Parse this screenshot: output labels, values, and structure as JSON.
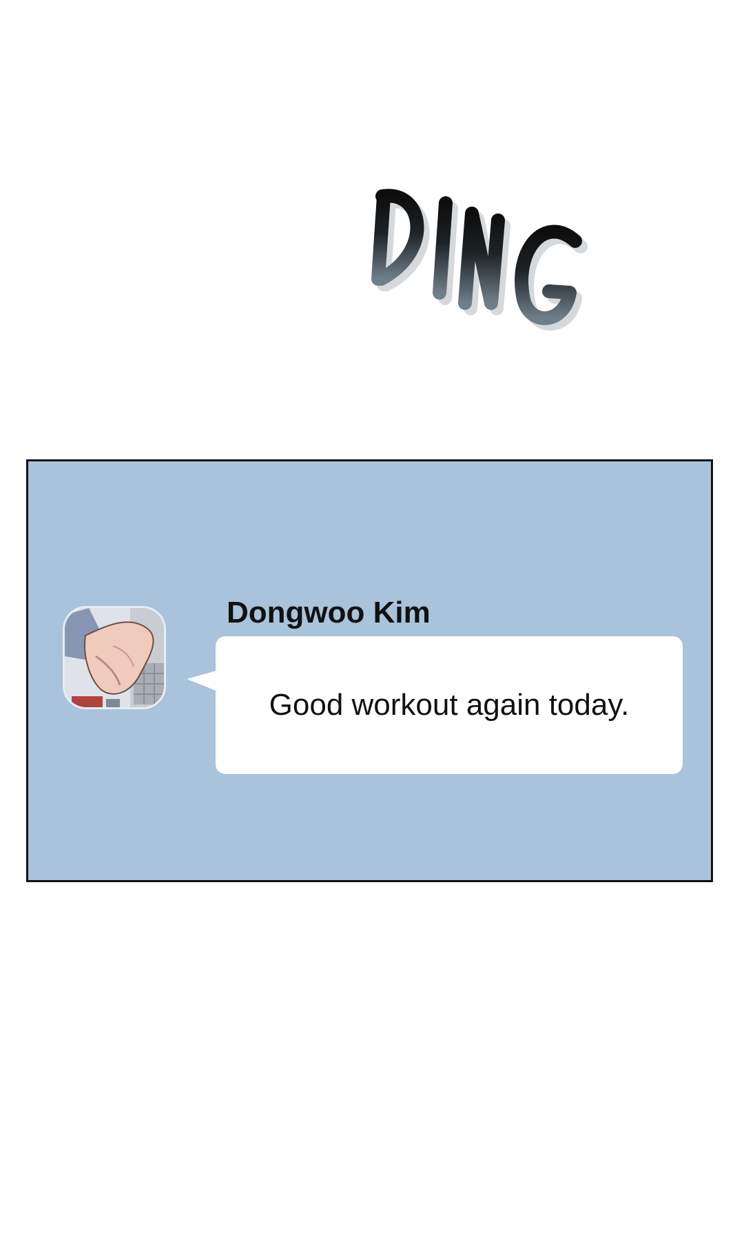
{
  "sound_effect": "DING",
  "chat": {
    "sender_name": "Dongwoo Kim",
    "message": "Good workout again today.",
    "avatar_icon": "flexed-arm-avatar"
  },
  "colors": {
    "panel_background": "#a8c3da",
    "panel_border": "#111111",
    "bubble_background": "#ffffff",
    "text": "#111111"
  }
}
